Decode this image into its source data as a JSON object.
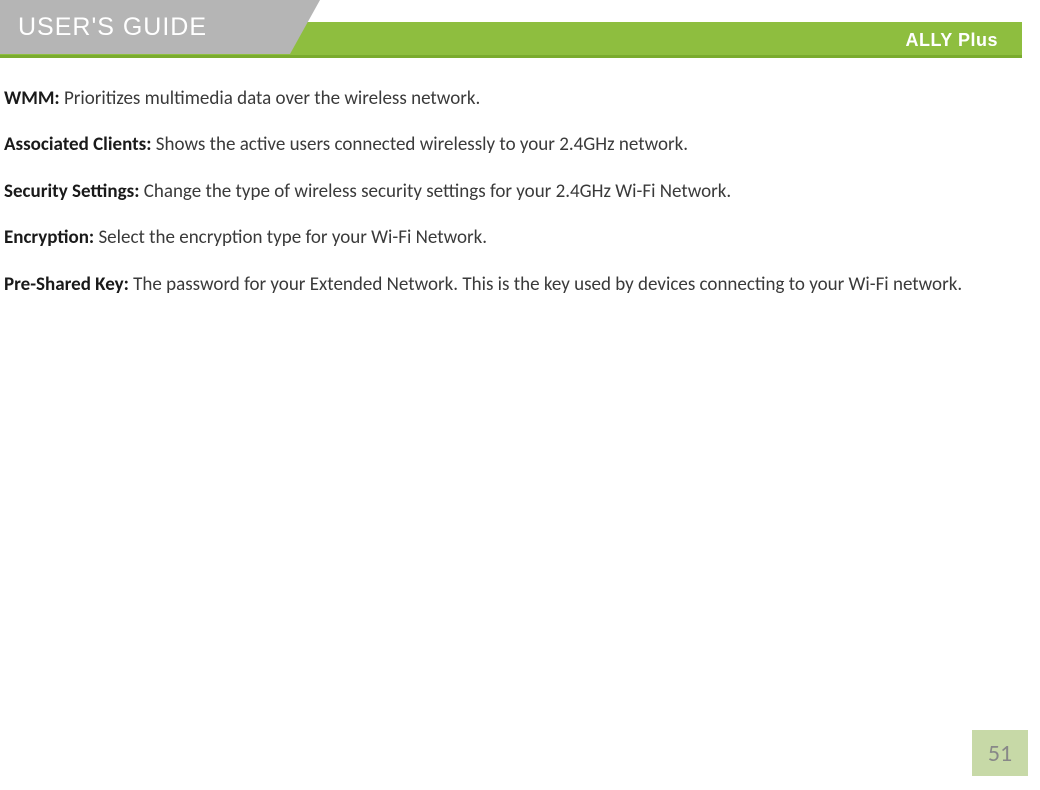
{
  "header": {
    "title": "USER'S GUIDE",
    "brand": "ALLY Plus"
  },
  "entries": [
    {
      "label": "WMM:",
      "text": " Prioritizes multimedia data over the wireless network."
    },
    {
      "label": "Associated Clients:",
      "text": " Shows the active users connected wirelessly to your 2.4GHz network."
    },
    {
      "label": "Security Settings:",
      "text": " Change the type of wireless security settings for your 2.4GHz Wi-Fi Network."
    },
    {
      "label": "Encryption:",
      "text": " Select the encryption type for your Wi-Fi Network."
    },
    {
      "label": "Pre-Shared Key:",
      "text": " The password for your Extended Network.  This is the key used by devices connecting to your Wi-Fi network."
    }
  ],
  "page_number": "51"
}
